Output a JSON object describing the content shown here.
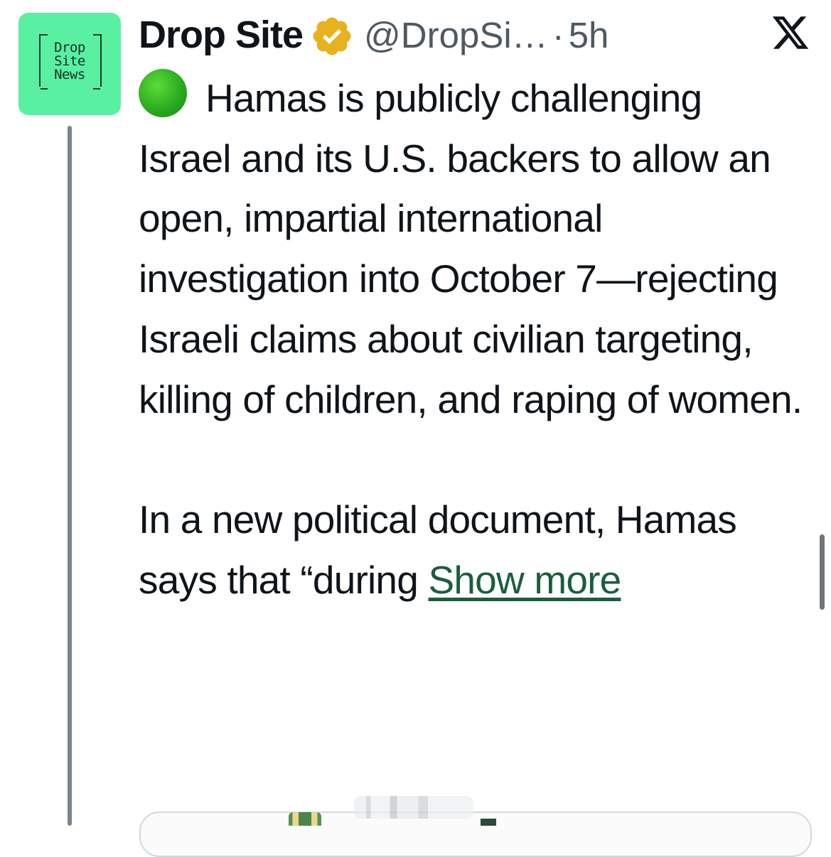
{
  "author": {
    "avatar_text_lines": [
      "Drop",
      "Site",
      "News"
    ],
    "display_name": "Drop Site",
    "handle": "@DropSi…",
    "separator": "·",
    "timestamp": "5h",
    "verified_badge_color": "#e8b21f"
  },
  "platform": {
    "logo_icon": "x-logo-icon"
  },
  "tweet": {
    "emoji": "green-circle",
    "paragraph_1": "Hamas is publicly challenging Israel and its U.S. backers to allow an open, impartial international investigation into October 7—rejecting Israeli claims about civilian targeting, killing of children, and raping of women.",
    "paragraph_2": "In a new political document, Hamas says that “during ",
    "show_more_label": "Show more"
  },
  "colors": {
    "avatar_background": "#5af0a2",
    "link": "#1a5e3c",
    "secondary_text": "#4f5962",
    "thread_line": "#7a8590"
  }
}
